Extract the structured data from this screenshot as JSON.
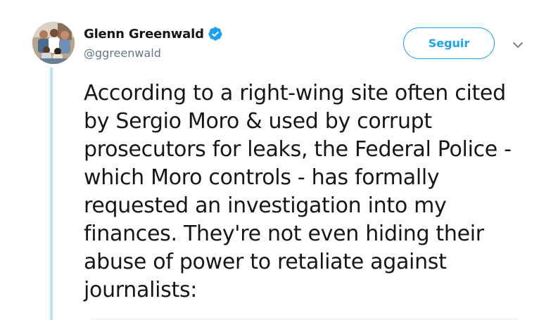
{
  "author": {
    "display_name": "Glenn Greenwald",
    "handle": "@ggreenwald",
    "verified": true,
    "avatar_icon": "avatar-photo"
  },
  "actions": {
    "follow_label": "Seguir",
    "menu_icon": "chevron-down-icon"
  },
  "tweet": {
    "lines": [
      "According to a right-wing site often cited",
      "by Sergio Moro & used by corrupt",
      "prosecutors for leaks, the Federal Police -",
      "which Moro controls - has formally",
      "requested an investigation into my",
      "finances. They're not even hiding their",
      "abuse of power to retaliate against",
      "journalists:"
    ]
  },
  "colors": {
    "accent": "#1da1f2",
    "thread_line": "#b9e1f5",
    "text": "#14171a",
    "secondary_text": "#657786"
  }
}
